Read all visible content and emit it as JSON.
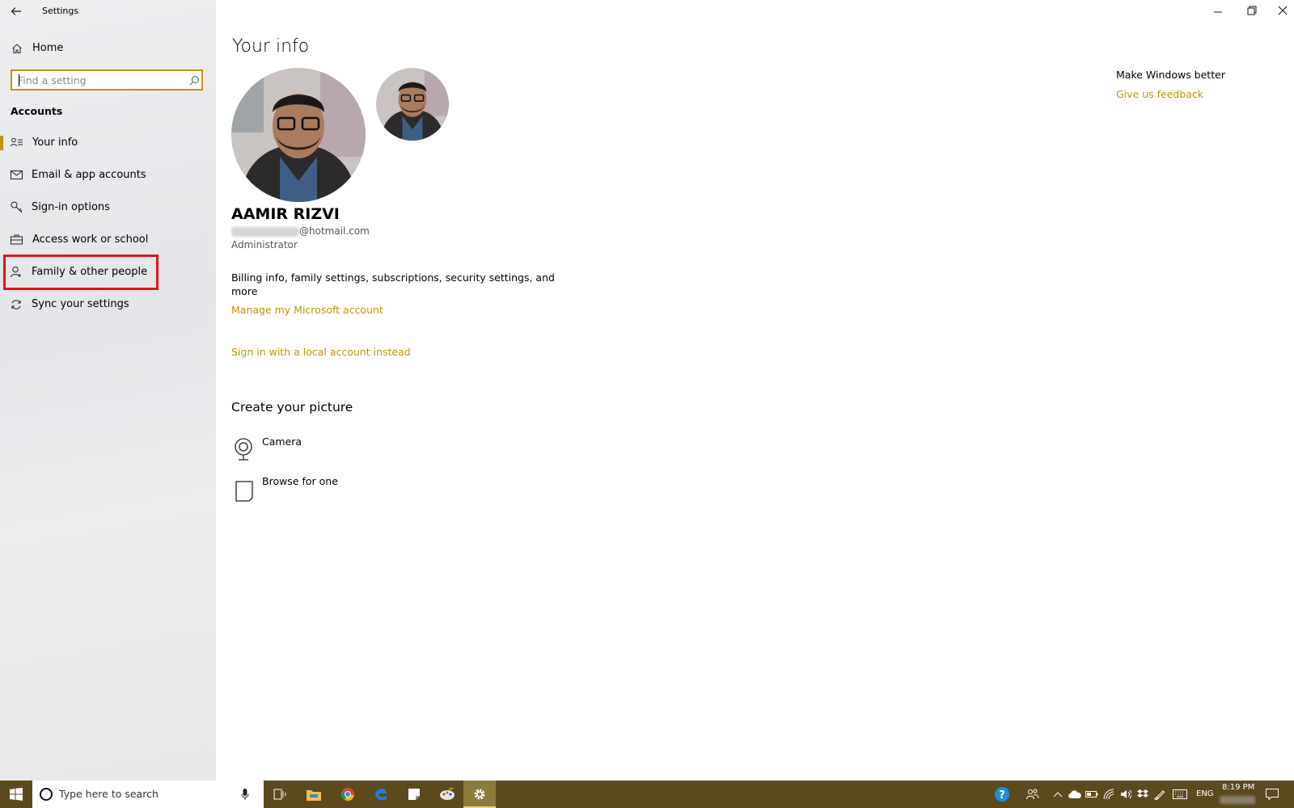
{
  "window": {
    "title": "Settings"
  },
  "sidebar": {
    "home": "Home",
    "search_placeholder": "Find a setting",
    "section": "Accounts",
    "items": [
      {
        "label": "Your info",
        "icon": "your-info-icon"
      },
      {
        "label": "Email & app accounts",
        "icon": "email-icon"
      },
      {
        "label": "Sign-in options",
        "icon": "key-icon"
      },
      {
        "label": "Access work or school",
        "icon": "briefcase-icon"
      },
      {
        "label": "Family & other people",
        "icon": "person-add-icon"
      },
      {
        "label": "Sync your settings",
        "icon": "sync-icon"
      }
    ]
  },
  "main": {
    "title": "Your info",
    "user_name": "AAMIR RIZVI",
    "email_domain": "@hotmail.com",
    "role": "Administrator",
    "billing_text_1": "Billing info, family settings, subscriptions, security settings, and",
    "billing_text_2": "more",
    "manage_link": "Manage my Microsoft account",
    "local_account_link": "Sign in with a local account instead",
    "create_picture_title": "Create your picture",
    "camera_label": "Camera",
    "browse_label": "Browse for one"
  },
  "right_panel": {
    "heading": "Make Windows better",
    "feedback_link": "Give us feedback"
  },
  "taskbar": {
    "search_placeholder": "Type here to search",
    "language": "ENG",
    "time": "8:19 PM"
  },
  "colors": {
    "accent": "#c2930a",
    "taskbar": "#5b4a1e",
    "highlight_box": "#e0141e"
  }
}
